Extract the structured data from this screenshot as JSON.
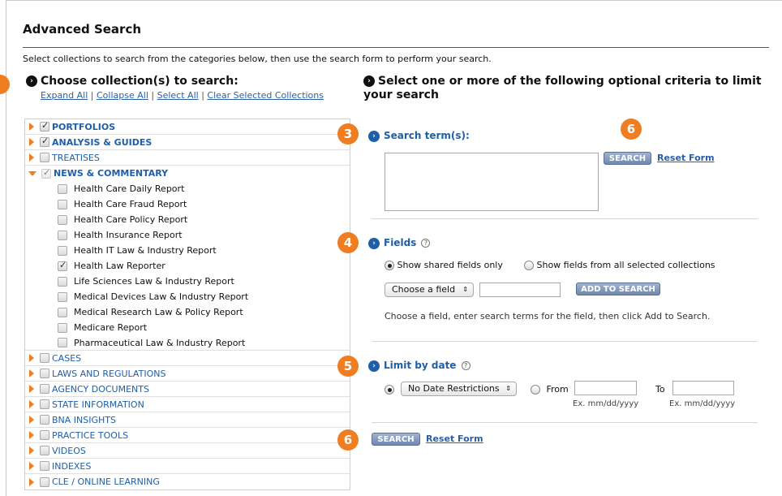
{
  "title": "Advanced Search",
  "instructions": "Select collections to search from the categories below, then use the search form to perform your search.",
  "left": {
    "heading": "Choose collection(s) to search:",
    "links": [
      "Expand All",
      "Collapse All",
      "Select All",
      "Clear Selected Collections"
    ],
    "separator": "|",
    "categories": [
      {
        "label": "PORTFOLIOS",
        "checked": true
      },
      {
        "label": "ANALYSIS & GUIDES",
        "checked": true
      },
      {
        "label": "TREATISES",
        "checked": false
      },
      {
        "label": "NEWS & COMMENTARY",
        "checked": true,
        "expanded": true
      },
      {
        "label": "CASES",
        "checked": false
      },
      {
        "label": "LAWS AND REGULATIONS",
        "checked": false
      },
      {
        "label": "AGENCY DOCUMENTS",
        "checked": false
      },
      {
        "label": "STATE INFORMATION",
        "checked": false
      },
      {
        "label": "BNA INSIGHTS",
        "checked": false
      },
      {
        "label": "PRACTICE TOOLS",
        "checked": false
      },
      {
        "label": "VIDEOS",
        "checked": false
      },
      {
        "label": "INDEXES",
        "checked": false
      },
      {
        "label": "CLE / ONLINE LEARNING",
        "checked": false
      }
    ],
    "subitems": [
      {
        "label": "Health Care Daily Report",
        "checked": false
      },
      {
        "label": "Health Care Fraud Report",
        "checked": false
      },
      {
        "label": "Health Care Policy Report",
        "checked": false
      },
      {
        "label": "Health Insurance Report",
        "checked": false
      },
      {
        "label": "Health IT Law & Industry Report",
        "checked": false
      },
      {
        "label": "Health Law Reporter",
        "checked": true
      },
      {
        "label": "Life Sciences Law & Industry Report",
        "checked": false
      },
      {
        "label": "Medical Devices Law & Industry Report",
        "checked": false
      },
      {
        "label": "Medical Research Law & Policy Report",
        "checked": false
      },
      {
        "label": "Medicare Report",
        "checked": false
      },
      {
        "label": "Pharmaceutical Law & Industry Report",
        "checked": false
      }
    ]
  },
  "right": {
    "heading": "Select one or more of the following optional criteria to limit your search",
    "search_terms": {
      "label": "Search term(s):",
      "value": ""
    },
    "search_button": "SEARCH",
    "reset_link": "Reset Form",
    "fields": {
      "label": "Fields",
      "radio_shared": "Show shared fields only",
      "radio_all": "Show fields from all selected collections",
      "selected_radio": "shared",
      "select_value": "Choose a field",
      "field_value": "",
      "add_button": "ADD TO SEARCH",
      "hint": "Choose a field, enter search terms for the field, then click Add to Search."
    },
    "date": {
      "label": "Limit by date",
      "select_value": "No Date Restrictions",
      "from_label": "From",
      "to_label": "To",
      "from_value": "",
      "to_value": "",
      "format_hint": "Ex. mm/dd/yyyy"
    }
  },
  "badges": {
    "three": "3",
    "four": "4",
    "five": "5",
    "six": "6"
  },
  "colors": {
    "accent": "#ef7d22",
    "link": "#2a5ea8",
    "button": "#7a93b8"
  },
  "icons": {
    "arrow": "›",
    "help": "?",
    "select_arrows": "⇕"
  }
}
